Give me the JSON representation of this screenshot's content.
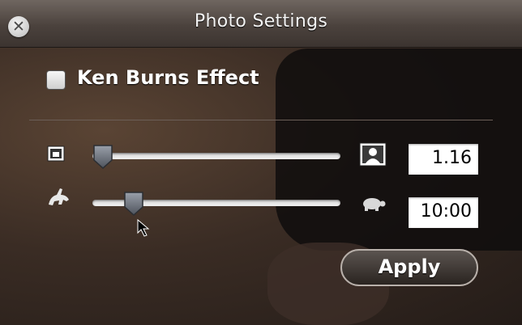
{
  "window": {
    "title": "Photo Settings"
  },
  "close_button": {
    "glyph": "✕",
    "icon": "close-icon"
  },
  "ken_burns": {
    "label": "Ken Burns Effect",
    "checked": false
  },
  "zoom": {
    "small_icon": "photo-small-icon",
    "large_icon": "portrait-icon",
    "value": "1.16",
    "slider_fraction": 0.04
  },
  "speed": {
    "fast_icon": "rabbit-icon",
    "slow_icon": "turtle-icon",
    "value": "10:00",
    "slider_fraction": 0.17
  },
  "apply": {
    "label": "Apply"
  },
  "colors": {
    "field_bg": "#ffffff",
    "text": "#ffffff",
    "title_bar": "#5a514c"
  }
}
